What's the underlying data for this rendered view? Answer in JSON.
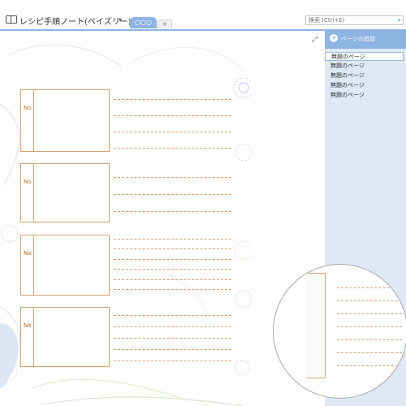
{
  "titlebar": {
    "notebook_title": "レシピ手順ノート(ペイズリー)",
    "dropdown_glyph": "▾",
    "tabs": [
      {
        "label": "○○○",
        "active": true
      },
      {
        "label": "+",
        "active": false
      }
    ],
    "search": {
      "placeholder": "検索 (Ctrl+E)",
      "value": ""
    }
  },
  "page": {
    "expand_glyph": "⤢",
    "recipe_steps": [
      {
        "label": "No"
      },
      {
        "label": "No"
      },
      {
        "label": "No"
      },
      {
        "label": "No"
      }
    ]
  },
  "sidebar": {
    "add_page_label": "ページの追加",
    "pages": [
      {
        "label": "無題のページ",
        "selected": true
      },
      {
        "label": "無題のページ",
        "selected": false
      },
      {
        "label": "無題のページ",
        "selected": false
      },
      {
        "label": "無題のページ",
        "selected": false
      },
      {
        "label": "無題のページ",
        "selected": false
      }
    ]
  },
  "colors": {
    "accent": "#8db4e2",
    "sidebar_bg": "#dfe8f5",
    "line": "#d5a074"
  }
}
